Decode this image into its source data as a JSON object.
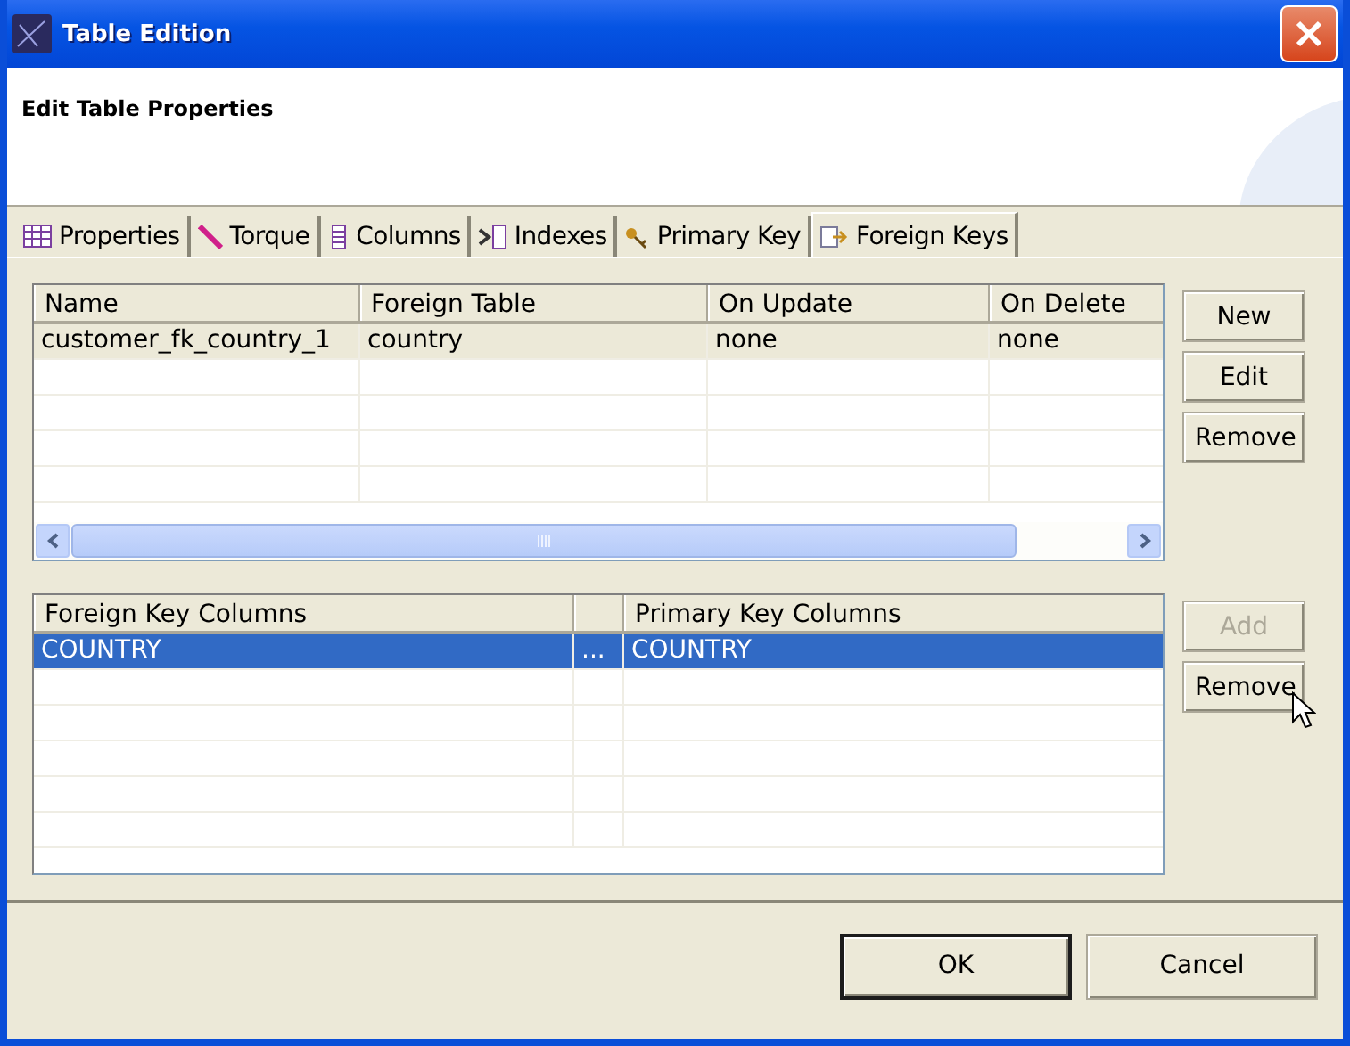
{
  "window": {
    "title": "Table Edition"
  },
  "header": {
    "title": "Edit Table Properties"
  },
  "tabs": [
    {
      "label": "Properties",
      "selected": false
    },
    {
      "label": "Torque",
      "selected": false
    },
    {
      "label": "Columns",
      "selected": false
    },
    {
      "label": "Indexes",
      "selected": false
    },
    {
      "label": "Primary Key",
      "selected": false
    },
    {
      "label": "Foreign Keys",
      "selected": true
    }
  ],
  "foreign_keys": {
    "focused": false,
    "columns": [
      "Name",
      "Foreign Table",
      "On Update",
      "On Delete"
    ],
    "rows": [
      {
        "cells": [
          "customer_fk_country_1",
          "country",
          "none",
          "none"
        ],
        "selected": true
      }
    ],
    "buttons": [
      {
        "label": "New",
        "disabled": false
      },
      {
        "label": "Edit",
        "disabled": false
      },
      {
        "label": "Remove",
        "disabled": false
      }
    ]
  },
  "key_columns": {
    "focused": true,
    "columns": [
      "Foreign Key Columns",
      "",
      "Primary Key Columns"
    ],
    "rows": [
      {
        "cells": [
          "COUNTRY",
          "...",
          "COUNTRY"
        ],
        "selected": true
      }
    ],
    "buttons": [
      {
        "label": "Add",
        "disabled": true
      },
      {
        "label": "Remove",
        "disabled": false
      }
    ]
  },
  "footer": {
    "buttons": [
      {
        "label": "OK",
        "default": true
      },
      {
        "label": "Cancel",
        "default": false
      }
    ]
  }
}
